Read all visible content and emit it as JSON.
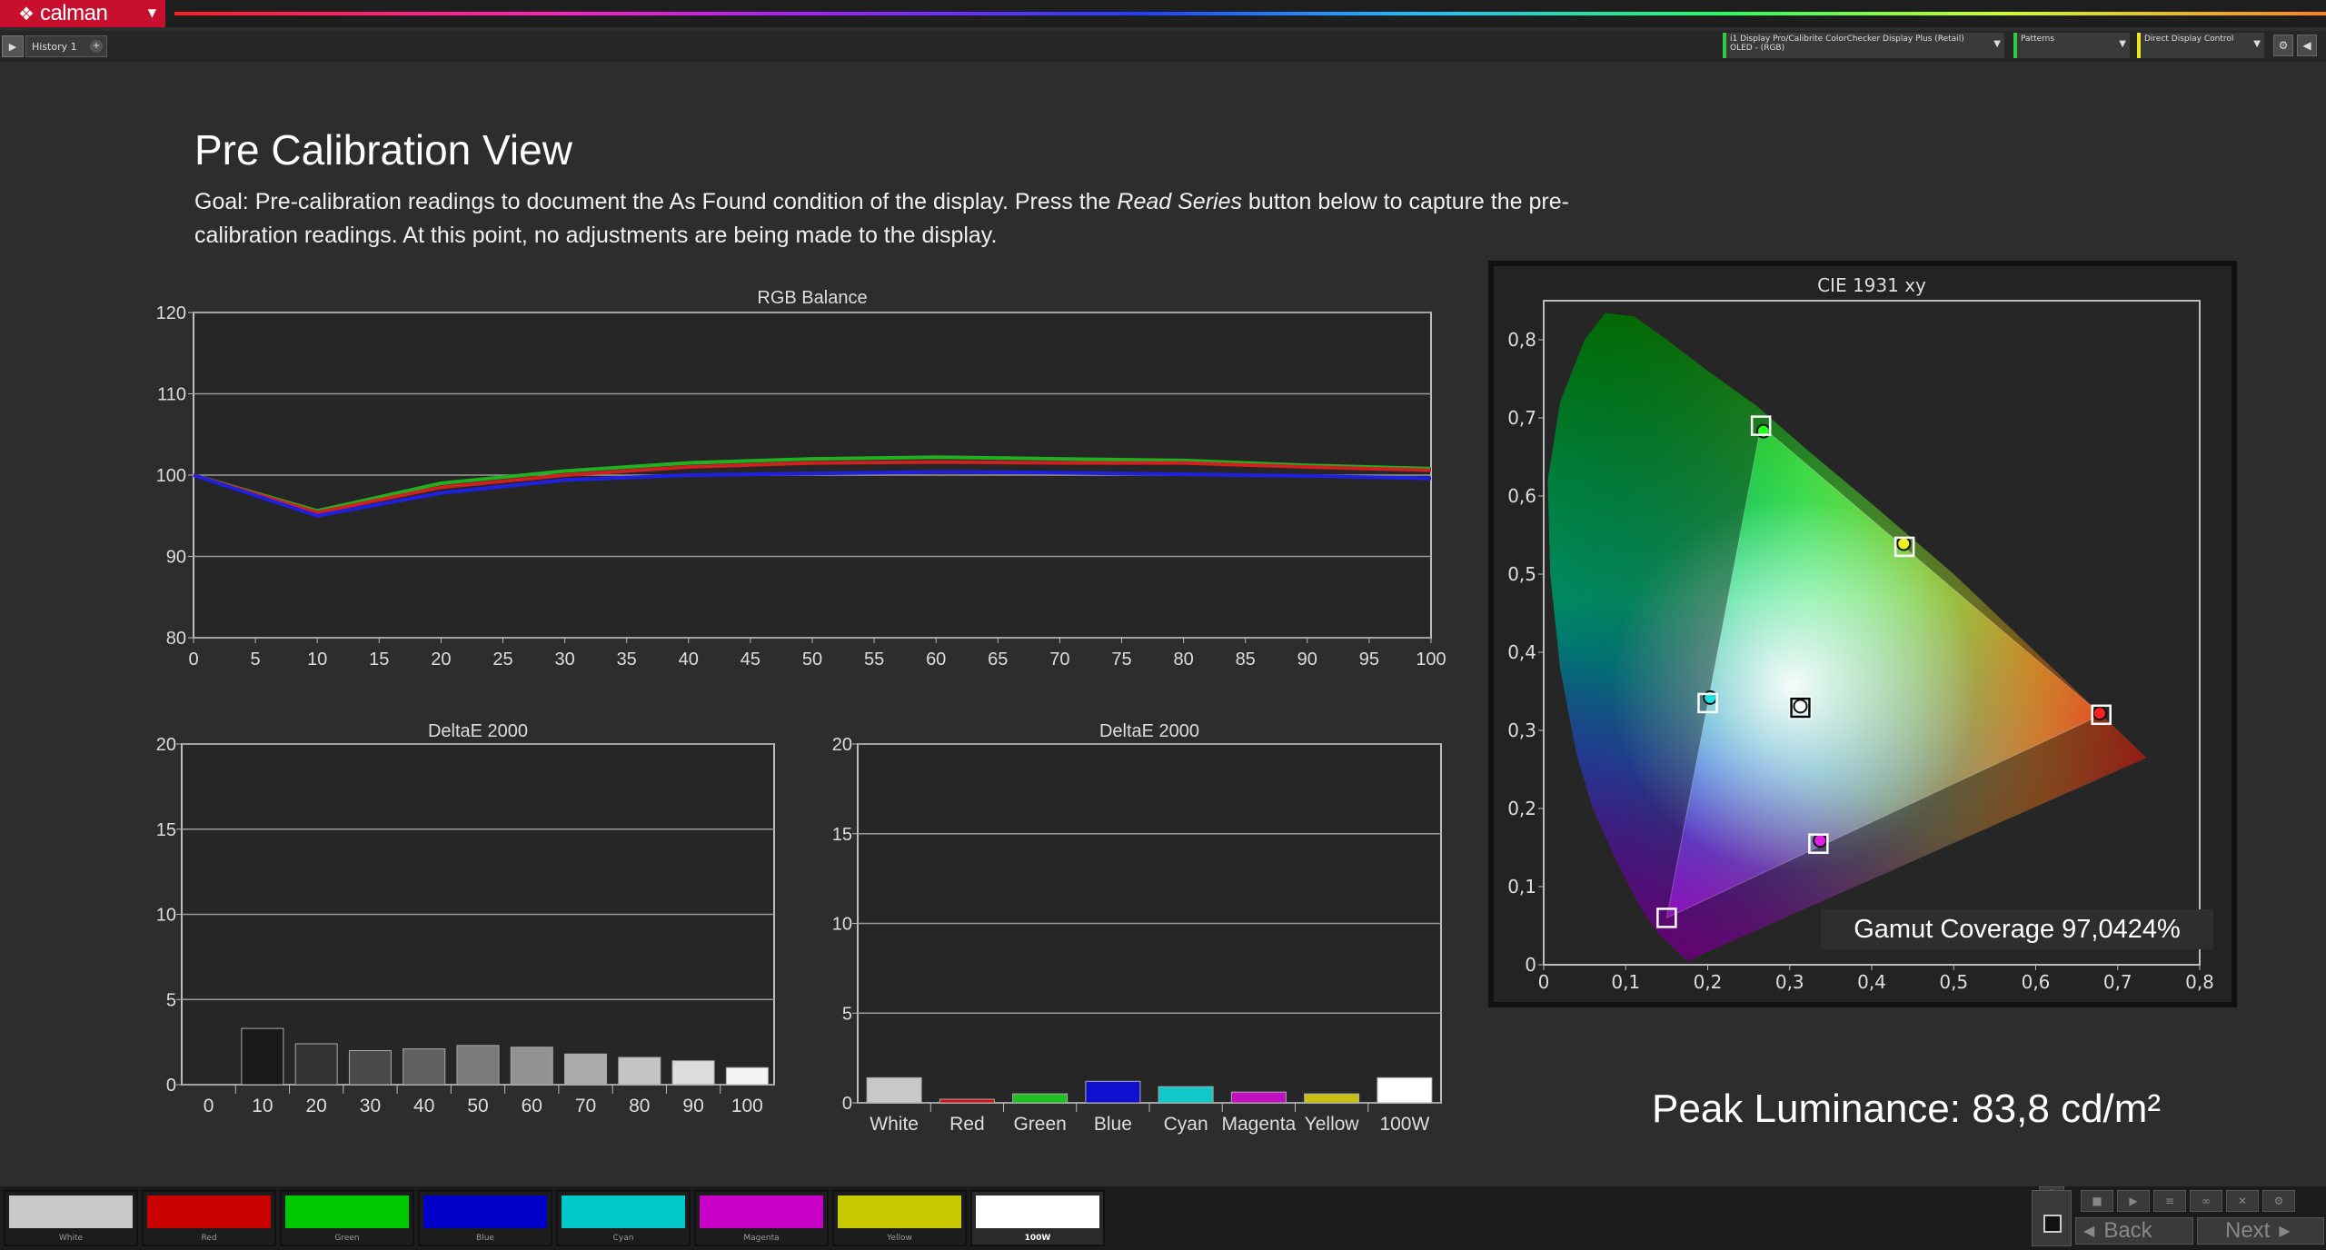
{
  "app": {
    "logo_text": "calman",
    "history_tab": "History 1",
    "dropdowns": {
      "meter": [
        "i1 Display Pro/Calibrite ColorChecker Display Plus (Retail)",
        "OLED - (RGB)"
      ],
      "patterns": "Patterns",
      "display_control": "Direct Display Control"
    }
  },
  "page": {
    "title": "Pre Calibration View",
    "goal_before": "Goal: Pre-calibration readings to document the As Found condition of the display. Press the ",
    "goal_em": "Read Series",
    "goal_after": " button below to capture the pre-calibration readings. At this point, no adjustments are being made to the display.",
    "gamut_coverage": "Gamut Coverage 97,0424%",
    "peak_luminance": "Peak Luminance: 83,8 cd/m²"
  },
  "colors": {
    "red": "#d01010",
    "green": "#20c020",
    "blue": "#1010d0",
    "cyan": "#10c8c8",
    "magenta": "#c010c0",
    "yellow": "#c8c010",
    "white": "#ffffff"
  },
  "chart_data": [
    {
      "type": "line",
      "title": "RGB Balance",
      "x": [
        0,
        10,
        20,
        30,
        40,
        50,
        60,
        70,
        80,
        90,
        100
      ],
      "xticks": [
        0,
        5,
        10,
        15,
        20,
        25,
        30,
        35,
        40,
        45,
        50,
        55,
        60,
        65,
        70,
        75,
        80,
        85,
        90,
        95,
        100
      ],
      "yticks": [
        80,
        90,
        100,
        110,
        120
      ],
      "ylim": [
        80,
        120
      ],
      "xlim": [
        0,
        100
      ],
      "series": [
        {
          "color": "#20b020",
          "values": [
            100,
            95.6,
            99.0,
            100.5,
            101.5,
            102.0,
            102.2,
            102.0,
            101.8,
            101.2,
            100.8
          ]
        },
        {
          "color": "#d02020",
          "values": [
            100,
            95.4,
            98.5,
            100.0,
            101.0,
            101.5,
            101.6,
            101.5,
            101.5,
            101.0,
            100.6
          ]
        },
        {
          "color": "#2020e0",
          "values": [
            100,
            95.0,
            97.8,
            99.4,
            100.0,
            100.2,
            100.4,
            100.3,
            100.1,
            99.9,
            99.6
          ]
        }
      ]
    },
    {
      "type": "bar",
      "title": "DeltaE 2000",
      "categories": [
        "0",
        "10",
        "20",
        "30",
        "40",
        "50",
        "60",
        "70",
        "80",
        "90",
        "100"
      ],
      "values": [
        0,
        3.3,
        2.4,
        2.0,
        2.1,
        2.3,
        2.2,
        1.8,
        1.6,
        1.4,
        1.0
      ],
      "bar_colors": [
        "#000000",
        "#1a1a1a",
        "#333333",
        "#4a4a4a",
        "#606060",
        "#7a7a7a",
        "#929292",
        "#ababab",
        "#c4c4c4",
        "#dcdcdc",
        "#f4f4f4"
      ],
      "yticks": [
        0,
        5,
        10,
        15,
        20
      ],
      "ylim": [
        0,
        20
      ]
    },
    {
      "type": "bar",
      "title": "DeltaE 2000",
      "categories": [
        "White",
        "Red",
        "Green",
        "Blue",
        "Cyan",
        "Magenta",
        "Yellow",
        "100W"
      ],
      "values": [
        1.4,
        0.2,
        0.5,
        1.2,
        0.9,
        0.6,
        0.5,
        1.4
      ],
      "bar_colors": [
        "#c8c8c8",
        "#d01010",
        "#20c020",
        "#1010d0",
        "#10c8c8",
        "#c010c0",
        "#c8c010",
        "#ffffff"
      ],
      "yticks": [
        0,
        5,
        10,
        15,
        20
      ],
      "ylim": [
        0,
        20
      ]
    },
    {
      "type": "scatter",
      "title": "CIE 1931 xy",
      "xlim": [
        0,
        0.8
      ],
      "ylim": [
        0,
        0.85
      ],
      "xticks": [
        "0",
        "0,1",
        "0,2",
        "0,3",
        "0,4",
        "0,5",
        "0,6",
        "0,7",
        "0,8"
      ],
      "yticks": [
        "0",
        "0,1",
        "0,2",
        "0,3",
        "0,4",
        "0,5",
        "0,6",
        "0,7",
        "0,8"
      ],
      "targets": [
        {
          "name": "Red",
          "x": 0.68,
          "y": 0.32
        },
        {
          "name": "Green",
          "x": 0.265,
          "y": 0.69
        },
        {
          "name": "Blue",
          "x": 0.15,
          "y": 0.06
        },
        {
          "name": "Cyan",
          "x": 0.2,
          "y": 0.335
        },
        {
          "name": "Magenta",
          "x": 0.335,
          "y": 0.155
        },
        {
          "name": "Yellow",
          "x": 0.44,
          "y": 0.535
        },
        {
          "name": "White",
          "x": 0.313,
          "y": 0.329
        }
      ],
      "measured": [
        {
          "name": "Red",
          "x": 0.678,
          "y": 0.322
        },
        {
          "name": "Green",
          "x": 0.268,
          "y": 0.683
        },
        {
          "name": "Cyan",
          "x": 0.203,
          "y": 0.342
        },
        {
          "name": "Magenta",
          "x": 0.337,
          "y": 0.159
        },
        {
          "name": "Yellow",
          "x": 0.439,
          "y": 0.539
        },
        {
          "name": "White",
          "x": 0.313,
          "y": 0.331
        }
      ]
    }
  ],
  "swatches": [
    {
      "label": "White",
      "color": "#c8c8c8"
    },
    {
      "label": "Red",
      "color": "#c80000"
    },
    {
      "label": "Green",
      "color": "#00c800"
    },
    {
      "label": "Blue",
      "color": "#0000c8"
    },
    {
      "label": "Cyan",
      "color": "#00c8c8"
    },
    {
      "label": "Magenta",
      "color": "#c800c8"
    },
    {
      "label": "Yellow",
      "color": "#c8c800"
    },
    {
      "label": "100W",
      "color": "#ffffff"
    }
  ],
  "nav": {
    "back": "Back",
    "next": "Next"
  }
}
